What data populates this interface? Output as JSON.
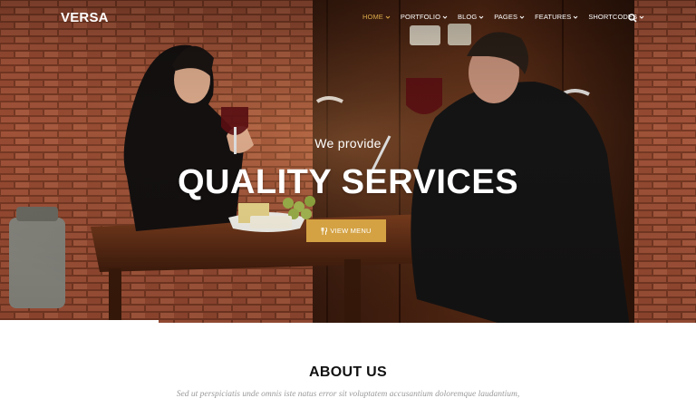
{
  "brand": {
    "logo": "VERSA"
  },
  "nav": {
    "items": [
      {
        "label": "HOME",
        "active": true
      },
      {
        "label": "PORTFOLIO",
        "active": false
      },
      {
        "label": "BLOG",
        "active": false
      },
      {
        "label": "PAGES",
        "active": false
      },
      {
        "label": "FEATURES",
        "active": false
      },
      {
        "label": "SHORTCODES",
        "active": false
      }
    ],
    "search_icon": "search-icon"
  },
  "hero": {
    "subtitle": "We provide",
    "title": "QUALITY SERVICES",
    "button_label": "VIEW MENU",
    "button_icon": "fork-knife-icon"
  },
  "about": {
    "title": "ABOUT US",
    "text": "Sed ut perspiciatis unde omnis iste natus error sit voluptatem accusantium doloremque laudantium,"
  },
  "colors": {
    "accent": "#d4a243",
    "active_nav": "#d9a84a",
    "heading": "#111111",
    "muted_text": "#9a9a9a"
  }
}
